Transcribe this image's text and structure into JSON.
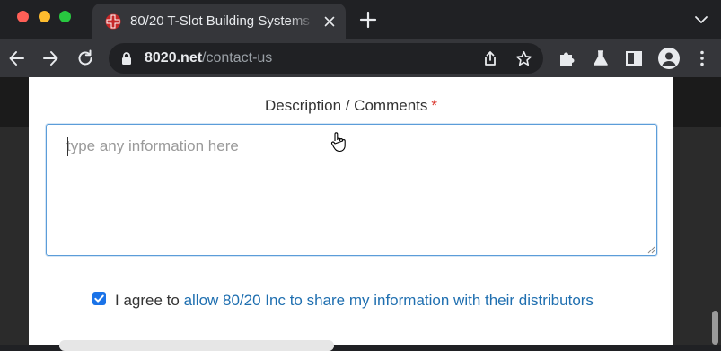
{
  "browser": {
    "tab": {
      "title": "80/20 T-Slot Building Systems"
    },
    "address": {
      "host": "8020.net",
      "path": "/contact-us"
    },
    "icons": [
      "back-icon",
      "forward-icon",
      "reload-icon",
      "lock-icon",
      "share-icon",
      "star-icon",
      "extensions-icon",
      "labs-icon",
      "sidepanel-icon",
      "profile-icon",
      "menu-icon"
    ]
  },
  "form": {
    "description_label": "Description / Comments",
    "required_marker": "*",
    "description_placeholder": "type any information here",
    "description_value": "",
    "consent": {
      "checked": true,
      "prefix": "I agree to",
      "link_text": "allow 80/20 Inc to share my information with their distributors"
    }
  },
  "colors": {
    "accent": "#1a73e8",
    "link": "#1f6fb0",
    "required": "#d9342b",
    "focus_border": "#5b9dd9"
  }
}
